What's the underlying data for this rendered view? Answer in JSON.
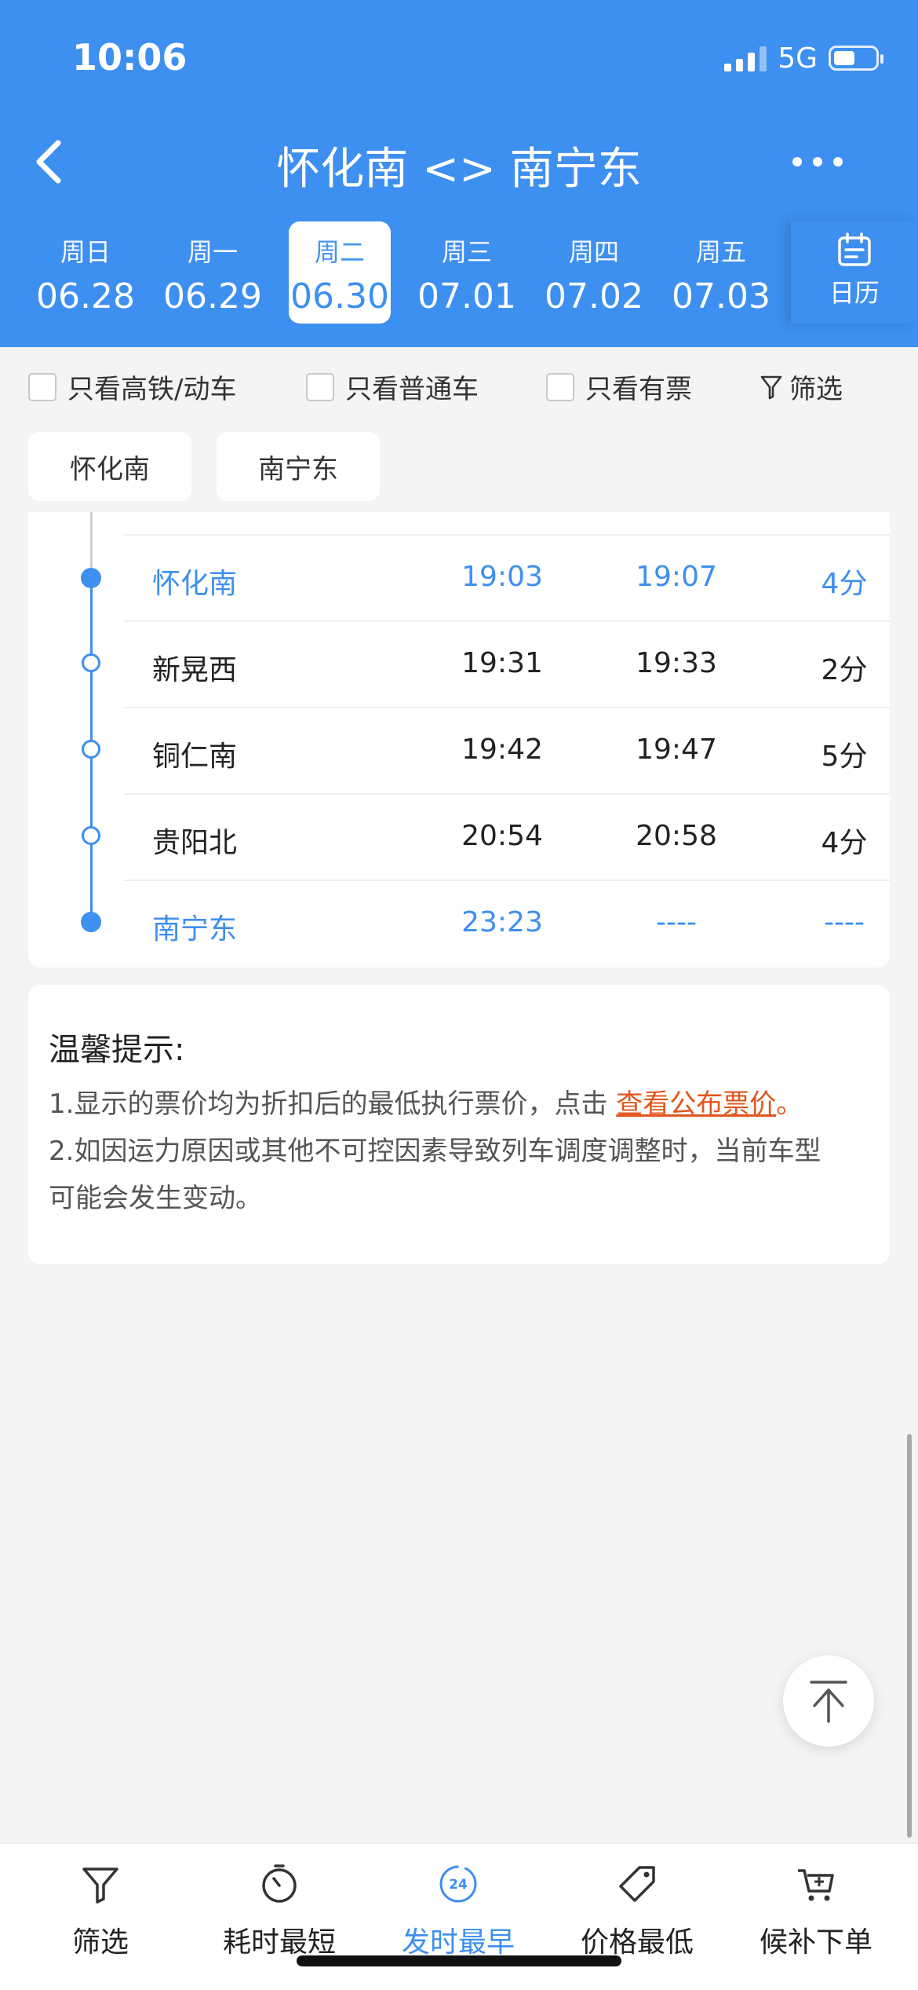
{
  "status_bar": {
    "time": "10:06",
    "network": "5G"
  },
  "header": {
    "title": "怀化南 <> 南宁东",
    "dates": [
      {
        "weekday": "周日",
        "date": "06.28",
        "active": false
      },
      {
        "weekday": "周一",
        "date": "06.29",
        "active": false
      },
      {
        "weekday": "周二",
        "date": "06.30",
        "active": true
      },
      {
        "weekday": "周三",
        "date": "07.01",
        "active": false
      },
      {
        "weekday": "周四",
        "date": "07.02",
        "active": false
      },
      {
        "weekday": "周五",
        "date": "07.03",
        "active": false
      }
    ],
    "calendar_label": "日历"
  },
  "filters": {
    "hsr_only": "只看高铁/动车",
    "normal_only": "只看普通车",
    "available_only": "只看有票",
    "filter": "筛选"
  },
  "station_tabs": [
    "怀化南",
    "南宁东"
  ],
  "stops": [
    {
      "name": "怀化南",
      "arrive": "19:03",
      "depart": "19:07",
      "stay": "4分",
      "highlight": true
    },
    {
      "name": "新晃西",
      "arrive": "19:31",
      "depart": "19:33",
      "stay": "2分",
      "highlight": false
    },
    {
      "name": "铜仁南",
      "arrive": "19:42",
      "depart": "19:47",
      "stay": "5分",
      "highlight": false
    },
    {
      "name": "贵阳北",
      "arrive": "20:54",
      "depart": "20:58",
      "stay": "4分",
      "highlight": false
    },
    {
      "name": "南宁东",
      "arrive": "23:23",
      "depart": "----",
      "stay": "----",
      "highlight": true
    }
  ],
  "tips": {
    "title": "温馨提示:",
    "line1_prefix": "1.显示的票价均为折扣后的最低执行票价，点击 ",
    "line1_link": "查看公布票价",
    "line1_suffix": "。",
    "line2": "2.如因运力原因或其他不可控因素导致列车调度调整时，当前车型",
    "line3": "可能会发生变动。"
  },
  "tabbar": [
    {
      "label": "筛选",
      "icon": "filter-icon",
      "active": false
    },
    {
      "label": "耗时最短",
      "icon": "stopwatch-icon",
      "active": false
    },
    {
      "label": "发时最早",
      "icon": "clock-24-icon",
      "active": true
    },
    {
      "label": "价格最低",
      "icon": "price-tag-icon",
      "active": false
    },
    {
      "label": "候补下单",
      "icon": "cart-plus-icon",
      "active": false
    }
  ],
  "colors": {
    "primary": "#3d8ff0",
    "link": "#e0561c",
    "background": "#f4f4f4"
  }
}
